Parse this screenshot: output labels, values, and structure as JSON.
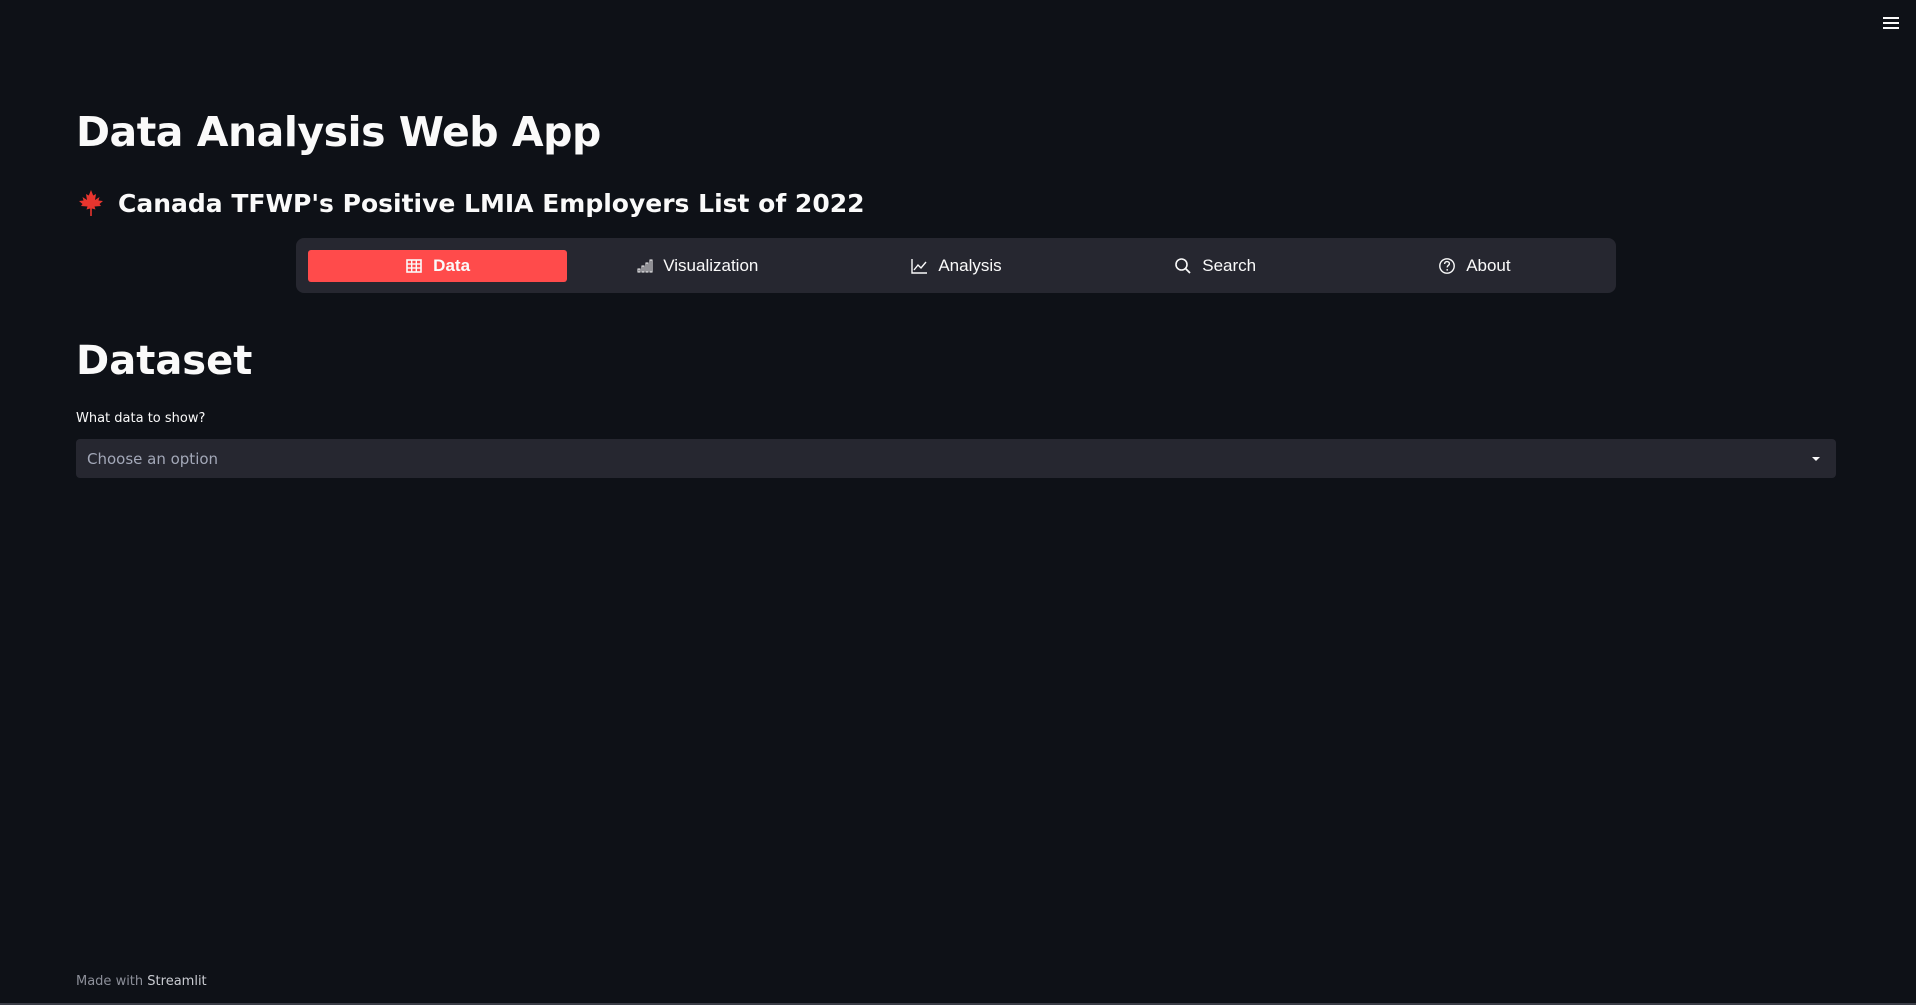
{
  "header": {
    "menu_icon": "hamburger-menu-icon"
  },
  "app": {
    "title": "Data Analysis Web App",
    "subtitle_icon": "maple-leaf-icon",
    "subtitle": "Canada TFWP's Positive LMIA Employers List of 2022"
  },
  "nav": {
    "items": [
      {
        "label": "Data",
        "icon": "table-icon",
        "active": true
      },
      {
        "label": "Visualization",
        "icon": "bar-chart-icon",
        "active": false
      },
      {
        "label": "Analysis",
        "icon": "line-chart-icon",
        "active": false
      },
      {
        "label": "Search",
        "icon": "search-icon",
        "active": false
      },
      {
        "label": "About",
        "icon": "question-circle-icon",
        "active": false
      }
    ],
    "active_color": "#ff4b4b",
    "background": "#262730"
  },
  "section": {
    "title": "Dataset",
    "field_label": "What data to show?",
    "select_placeholder": "Choose an option"
  },
  "footer": {
    "prefix": "Made with",
    "brand": "Streamlit"
  },
  "colors": {
    "background": "#0e1117",
    "text": "#fafafa",
    "accent": "#ff4b4b"
  }
}
